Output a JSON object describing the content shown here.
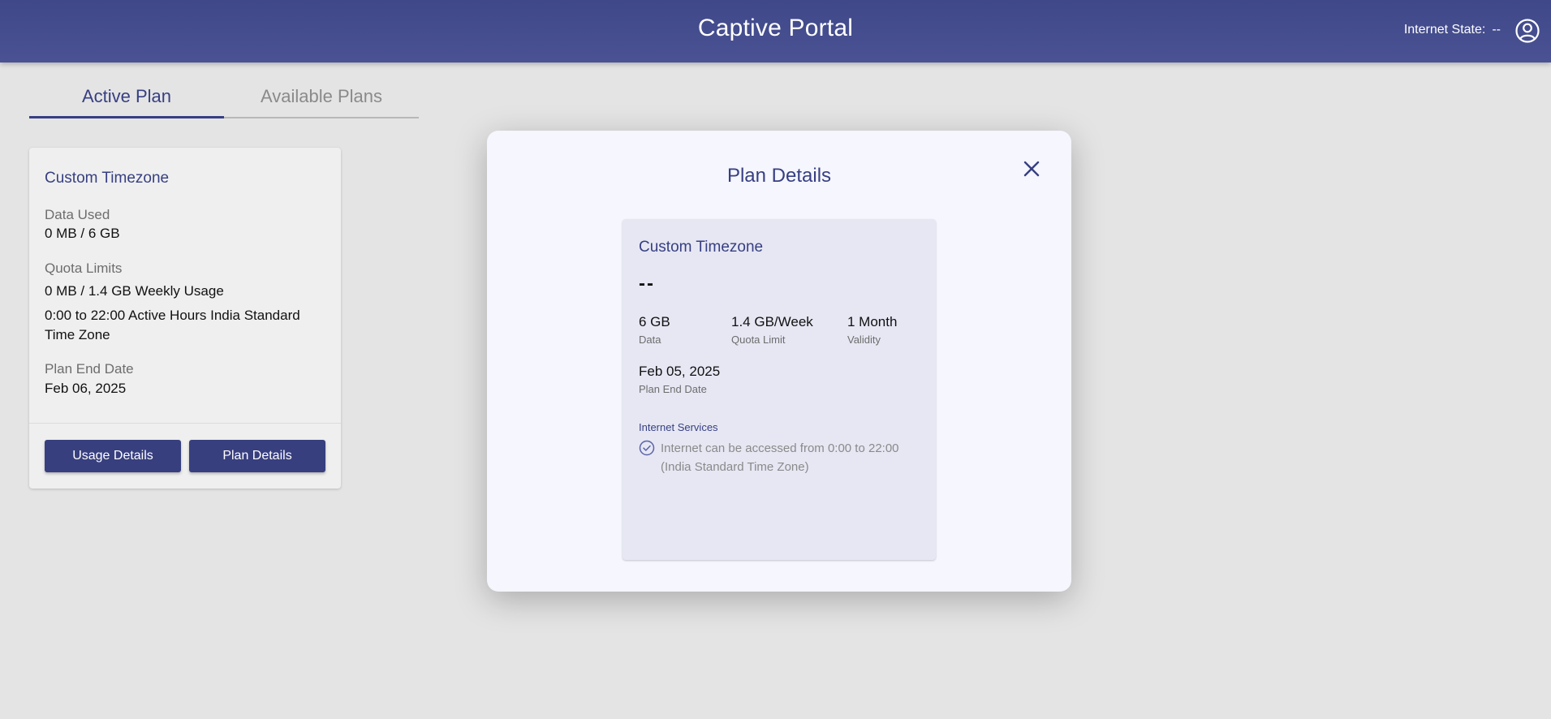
{
  "header": {
    "title": "Captive Portal",
    "internet_state_label": "Internet State:",
    "internet_state_value": "--"
  },
  "tabs": [
    {
      "label": "Active Plan",
      "active": true
    },
    {
      "label": "Available Plans",
      "active": false
    }
  ],
  "active_plan": {
    "name": "Custom Timezone",
    "data_used_label": "Data Used",
    "data_used_value": "0 MB / 6 GB",
    "quota_label": "Quota Limits",
    "quota_weekly": "0 MB / 1.4 GB Weekly Usage",
    "quota_hours": "0:00 to 22:00 Active Hours India Standard Time Zone",
    "end_label": "Plan End Date",
    "end_value": "Feb 06, 2025",
    "usage_button": "Usage Details",
    "details_button": "Plan Details"
  },
  "modal": {
    "title": "Plan Details",
    "card": {
      "name": "Custom Timezone",
      "price": "--",
      "data_value": "6 GB",
      "data_label": "Data",
      "quota_value": "1.4 GB/Week",
      "quota_label": "Quota Limit",
      "validity_value": "1 Month",
      "validity_label": "Validity",
      "end_value": "Feb 05, 2025",
      "end_label": "Plan End Date",
      "services_heading": "Internet Services",
      "services_note": "Internet can be accessed from 0:00 to 22:00 (India Standard Time Zone)"
    }
  },
  "icons": {
    "avatar": "user-circle-icon",
    "close": "close-icon",
    "check": "check-circle-icon"
  },
  "colors": {
    "brand": "#373f82",
    "header": "#434b8d",
    "button": "#383f7f"
  }
}
